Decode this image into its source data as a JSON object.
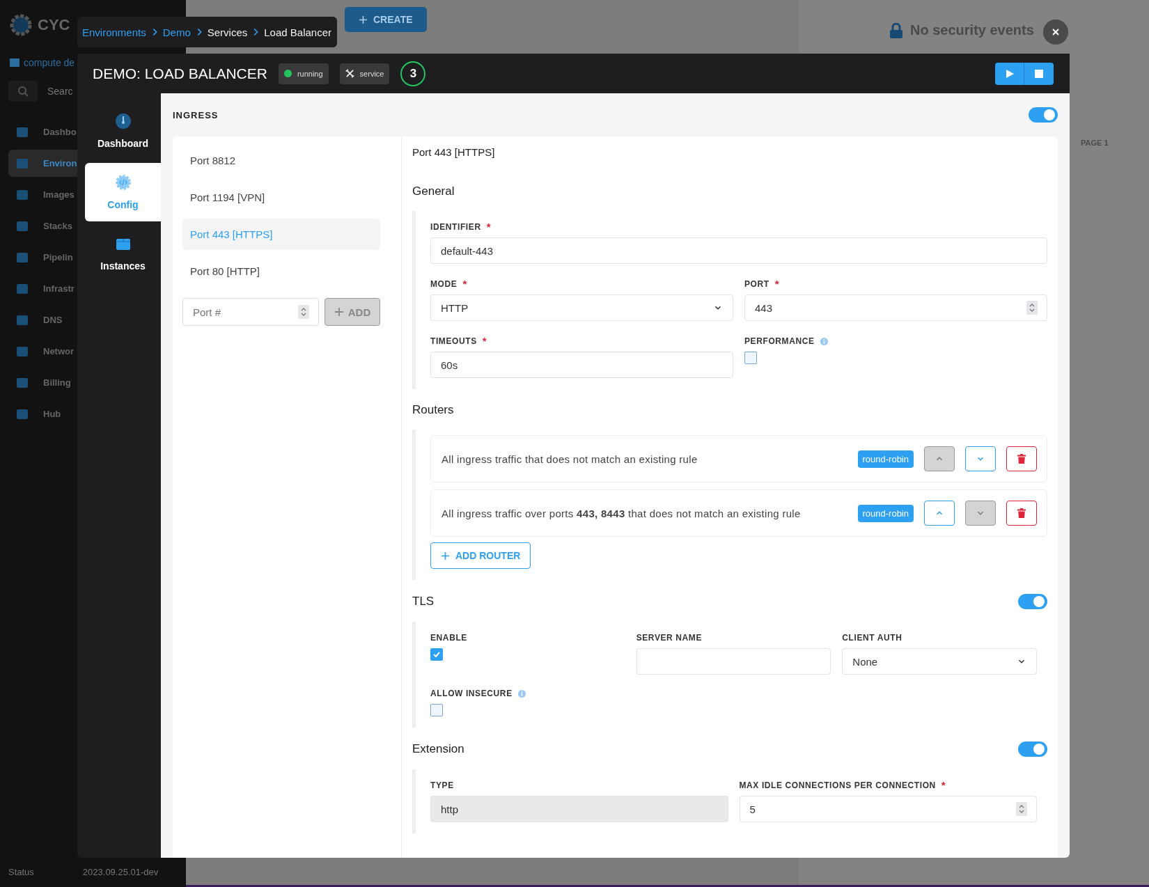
{
  "background": {
    "logo_text": "CYC",
    "project": "compute de",
    "search": {
      "placeholder": "Searc"
    },
    "nav": [
      {
        "label": "Dashbo",
        "selected": false
      },
      {
        "label": "Environ",
        "selected": true
      },
      {
        "label": "Images",
        "selected": false
      },
      {
        "label": "Stacks",
        "selected": false
      },
      {
        "label": "Pipelin",
        "selected": false
      },
      {
        "label": "Infrastr",
        "selected": false
      },
      {
        "label": "DNS",
        "selected": false
      },
      {
        "label": "Networ",
        "selected": false
      },
      {
        "label": "Billing",
        "selected": false
      },
      {
        "label": "Hub",
        "selected": false
      }
    ],
    "create_button": "CREATE",
    "security_message": "No security events",
    "pager": "PAGE 1",
    "status": "Status",
    "version": "2023.09.25.01-dev"
  },
  "breadcrumb": [
    {
      "label": "Environments",
      "link": true
    },
    {
      "label": "Demo",
      "link": true
    },
    {
      "label": "Services",
      "link": false
    },
    {
      "label": "Load Balancer",
      "link": false
    }
  ],
  "modal": {
    "title": "DEMO: LOAD BALANCER",
    "status": {
      "label": "running",
      "color": "#22c55e"
    },
    "type_badge": "service",
    "instance_count": "3"
  },
  "side_nav": [
    {
      "label": "Dashboard",
      "kind": "gauge",
      "selected": false
    },
    {
      "label": "Config",
      "kind": "config",
      "selected": true
    },
    {
      "label": "Instances",
      "kind": "box",
      "selected": false
    }
  ],
  "ingress": {
    "title": "INGRESS",
    "on": true,
    "ports": [
      {
        "label": "Port 8812",
        "selected": false
      },
      {
        "label": "Port 1194 [VPN]",
        "selected": false
      },
      {
        "label": "Port 443 [HTTPS]",
        "selected": true
      },
      {
        "label": "Port 80 [HTTP]",
        "selected": false
      }
    ],
    "port_input": {
      "placeholder": "Port #"
    },
    "add_button": {
      "label": "ADD",
      "disabled": true
    },
    "detail": {
      "title": "Port 443 [HTTPS]",
      "general": {
        "title": "General",
        "fields": [
          {
            "label": "IDENTIFIER",
            "kind": "text",
            "value": "default-443",
            "required_mark": "*",
            "info": false
          },
          {
            "label": "MODE",
            "kind": "select",
            "value": "HTTP",
            "required_mark": "*",
            "info": false
          },
          {
            "label": "PORT",
            "kind": "number",
            "value": "443",
            "required_mark": "*",
            "info": false
          },
          {
            "label": "TIMEOUTS",
            "kind": "text",
            "value": "60s",
            "required_mark": "*",
            "info": false
          },
          {
            "label": "PERFORMANCE",
            "kind": "checkbox",
            "checked": false,
            "info": true
          }
        ]
      },
      "routers": {
        "title": "Routers",
        "items": [
          {
            "description": "All ingress traffic that does not match an existing rule",
            "algorithm": "round-robin",
            "up_disabled": true,
            "down_disabled": false
          },
          {
            "description": "All ingress traffic over ports **443, 8443** that does not match an existing rule",
            "algorithm": "round-robin",
            "up_disabled": false,
            "down_disabled": true
          }
        ],
        "add_button": "ADD ROUTER"
      },
      "tls": {
        "title": "TLS",
        "on": true,
        "fields": [
          {
            "label": "ENABLE",
            "kind": "checkbox",
            "checked": true,
            "info": false
          },
          {
            "label": "SERVER NAME",
            "kind": "text",
            "info": false
          },
          {
            "label": "CLIENT AUTH",
            "kind": "select",
            "value": "None",
            "info": false
          },
          {
            "label": "ALLOW INSECURE",
            "kind": "checkbox",
            "checked": false,
            "info": true
          }
        ]
      },
      "extension": {
        "title": "Extension",
        "on": true,
        "fields": [
          {
            "label": "TYPE",
            "kind": "text",
            "value": "http",
            "disabled": true,
            "info": false
          },
          {
            "label": "MAX IDLE CONNECTIONS PER CONNECTION",
            "kind": "number",
            "value": "5",
            "required_mark": "*",
            "info": false
          }
        ]
      }
    }
  }
}
